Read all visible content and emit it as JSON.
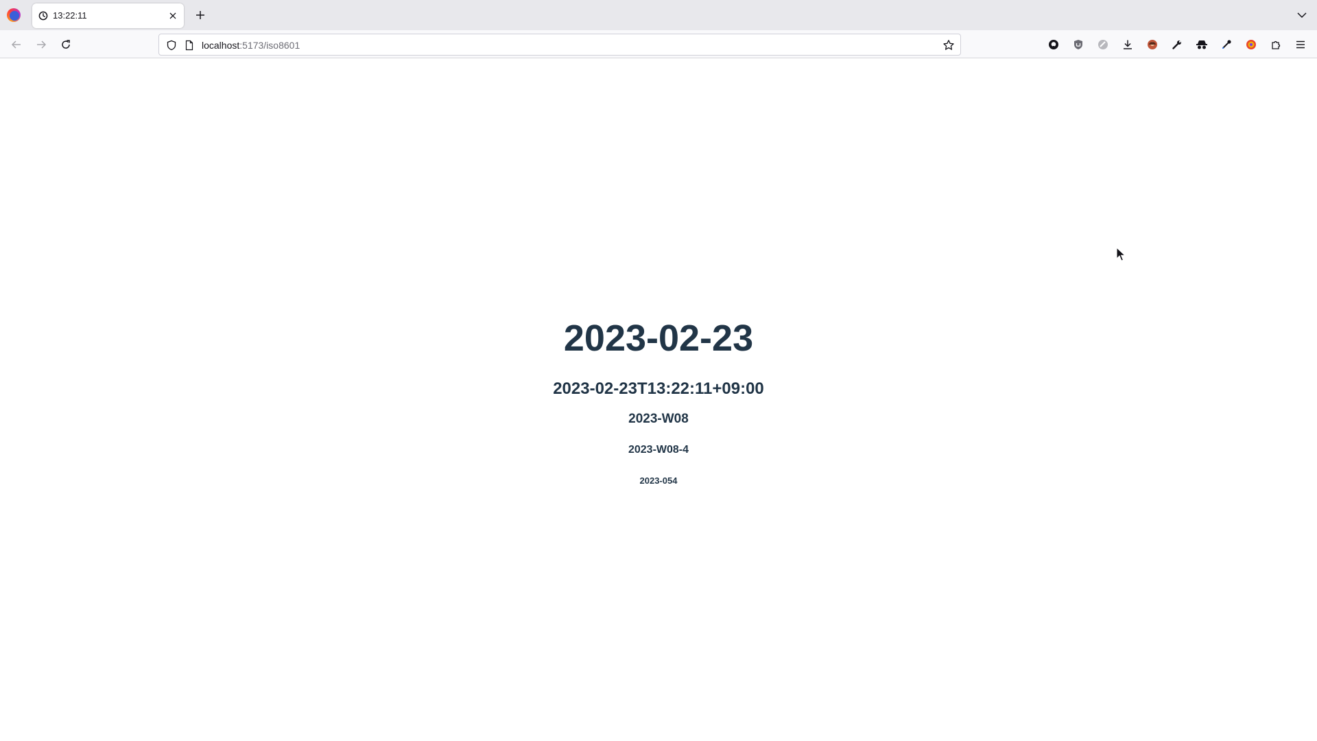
{
  "browser": {
    "tab": {
      "title": "13:22:11"
    },
    "url": {
      "host": "localhost",
      "path": ":5173/iso8601"
    }
  },
  "icons": {
    "logo": "firefox-logo-icon",
    "tab": "clock-icon",
    "toolbar": [
      "back-icon",
      "forward-icon",
      "reload-icon"
    ],
    "extensions": [
      "github-icon",
      "shield-extension-icon",
      "circle-extension-icon",
      "downloads-icon",
      "avatar-extension-icon",
      "wrench-icon",
      "incognito-icon",
      "eyedropper-icon",
      "color-extension-icon",
      "extensions-puzzle-icon",
      "hamburger-menu-icon"
    ]
  },
  "colors": {
    "text": "#213547",
    "tabstrip": "#e8e8ec",
    "navbar": "#f9f9fb"
  },
  "page": {
    "date": "2023-02-23",
    "datetime": "2023-02-23T13:22:11+09:00",
    "week": "2023-W08",
    "week_day": "2023-W08-4",
    "ordinal": "2023-054"
  }
}
